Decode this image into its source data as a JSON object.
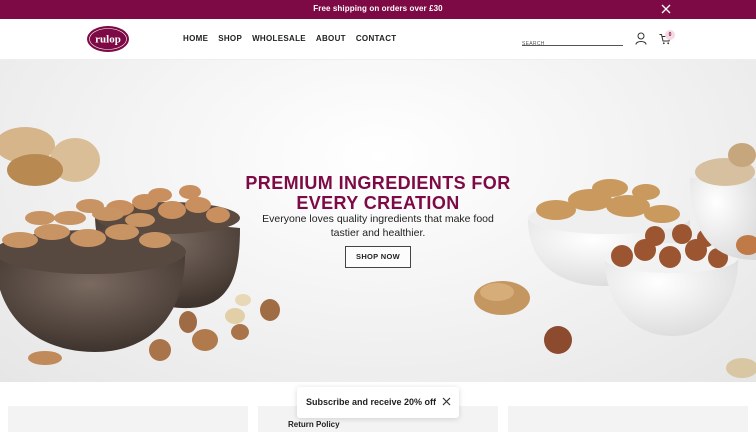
{
  "announcement": {
    "text": "Free shipping on orders over £30",
    "close_icon": "close-icon"
  },
  "brand": {
    "logo_text": "rulop",
    "color": "#7d0a45"
  },
  "nav": {
    "items": [
      "HOME",
      "SHOP",
      "WHOLESALE",
      "ABOUT",
      "CONTACT"
    ]
  },
  "search": {
    "placeholder": "SEARCH"
  },
  "header_icons": {
    "account": "user-icon",
    "cart": "cart-icon",
    "cart_count": "0"
  },
  "hero": {
    "title_line1": "PREMIUM INGREDIENTS FOR",
    "title_line2": "EVERY CREATION",
    "subtitle_line1": "Everyone loves quality ingredients that make food",
    "subtitle_line2": "tastier and healthier.",
    "cta": "SHOP NOW"
  },
  "info_cards": {
    "card2_label": "Return Policy"
  },
  "popup": {
    "text": "Subscribe and receive 20% off",
    "close_icon": "close-icon"
  },
  "colors": {
    "accent": "#7d0a45",
    "badge_bg": "#f7d9e3"
  }
}
